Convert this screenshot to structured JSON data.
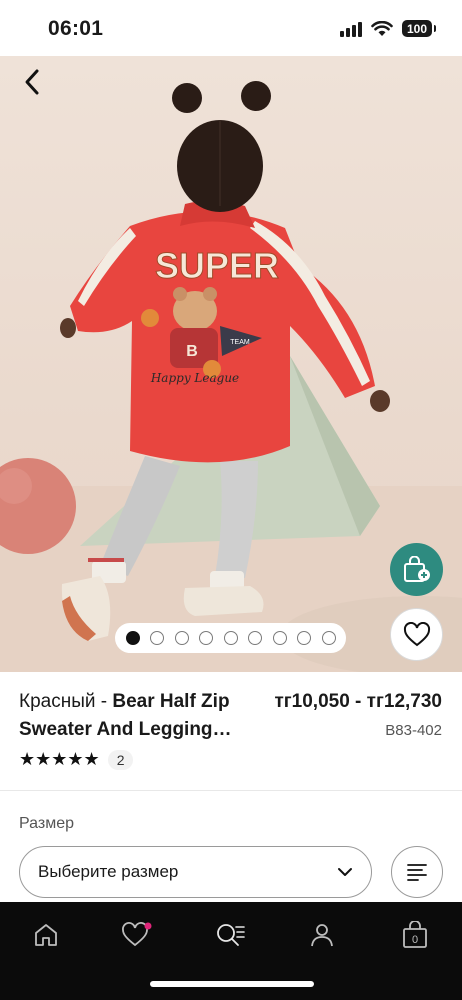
{
  "status_bar": {
    "time": "06:01",
    "battery": "100",
    "icons": [
      "signal-icon",
      "wifi-icon",
      "battery-icon"
    ]
  },
  "hero": {
    "back_icon": "chevron-left-icon",
    "bag_icon": "bag-plus-icon",
    "favorite_icon": "heart-icon",
    "image_count": 9,
    "active_index": 0,
    "accent_color": "#2e8b80",
    "sweater_print": {
      "line1": "SUPER",
      "badge": "B",
      "pennant": "TEAM",
      "script": "Happy League"
    }
  },
  "product": {
    "color": "Красный - ",
    "name": "Bear Half Zip Sweater And Legging…",
    "price": "тг10,050 - тг12,730",
    "sku": "B83-402",
    "stars": "★★★★★",
    "review_count": "2"
  },
  "size": {
    "label": "Размер",
    "placeholder": "Выберите размер",
    "dropdown_icon": "chevron-down-icon",
    "guide_icon": "size-guide-icon"
  },
  "bottom_nav": {
    "items": [
      "home-icon",
      "heart-icon",
      "search-icon",
      "user-icon",
      "bag-icon"
    ],
    "bag_count": "0",
    "badge_color": "#e0267a"
  }
}
